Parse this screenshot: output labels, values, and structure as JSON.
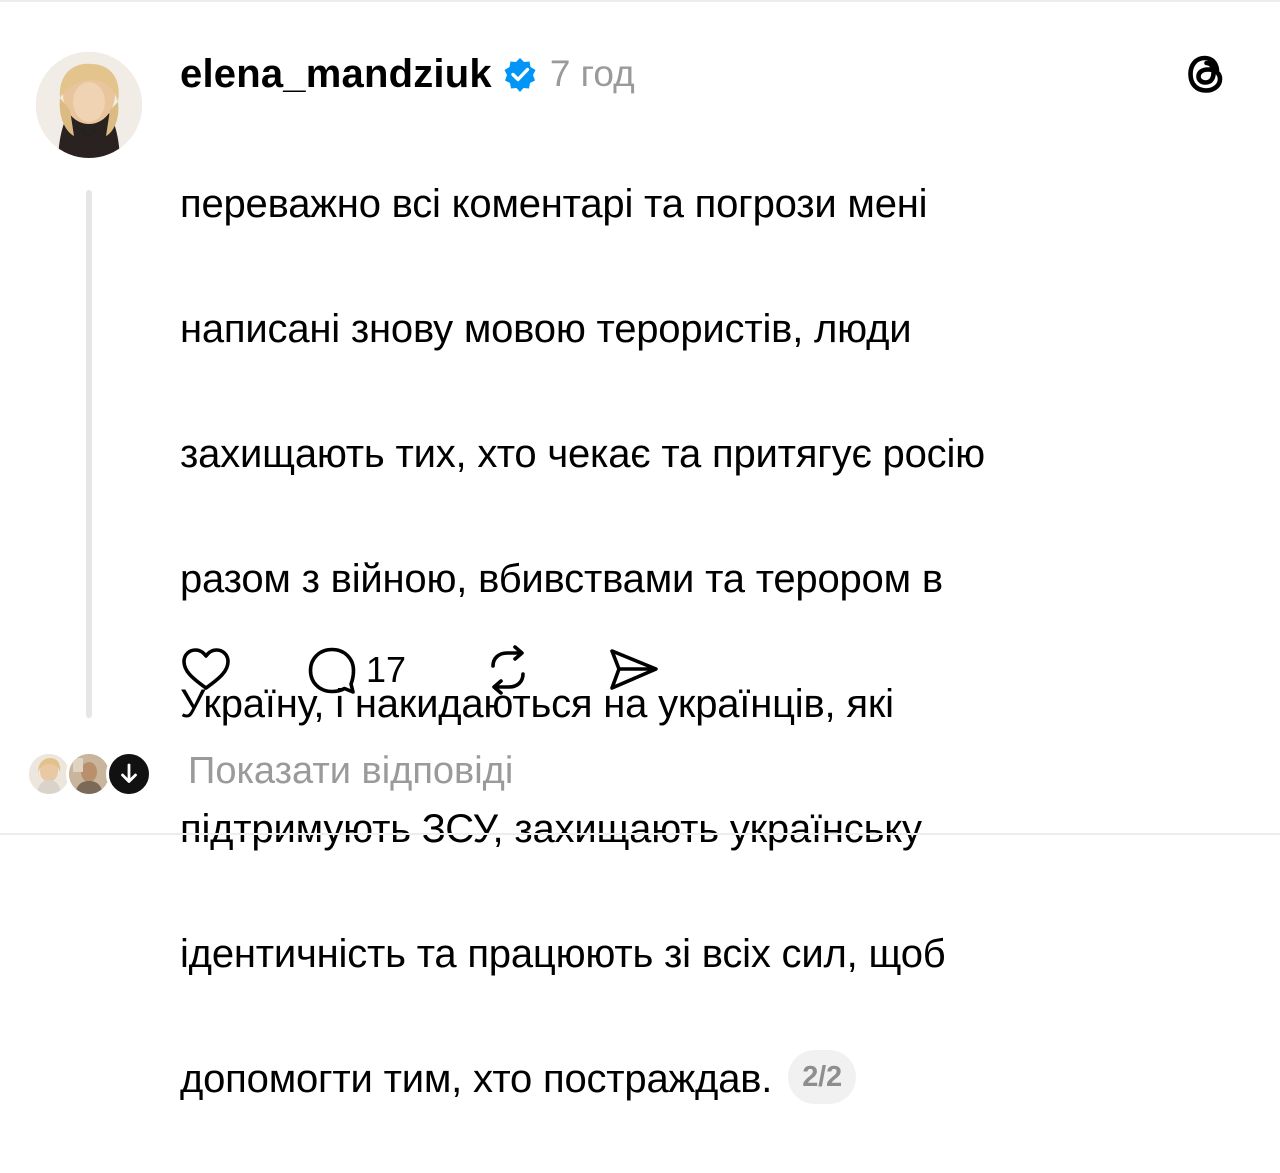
{
  "post": {
    "username": "elena_mandziuk",
    "verified": true,
    "time": "7 год",
    "lines": [
      "переважно всі коментарі та погрози мені",
      "написані знову мовою терористів,  люди",
      "захищають тих, хто чекає та притягує росію",
      "разом з війною, вбивствами та терором в",
      "Україну, і накидаються на українців, які",
      "підтримують ЗСУ, захищають українську",
      "ідентичність та працюють зі всіх сил, щоб",
      "допомогти тим, хто постраждав."
    ],
    "pager": "2/2",
    "comment_count": "17"
  },
  "icons": {
    "verified": "verified-badge-icon",
    "threads": "threads-logo-icon",
    "like": "heart-icon",
    "comment": "comment-bubble-icon",
    "repost": "repost-icon",
    "share": "send-icon",
    "expand": "arrow-down-icon"
  },
  "replies": {
    "label": "Показати відповіді"
  },
  "colors": {
    "verified": "#0095f6",
    "muted": "#9a9a9a",
    "pager_bg": "#f1f1f1"
  }
}
